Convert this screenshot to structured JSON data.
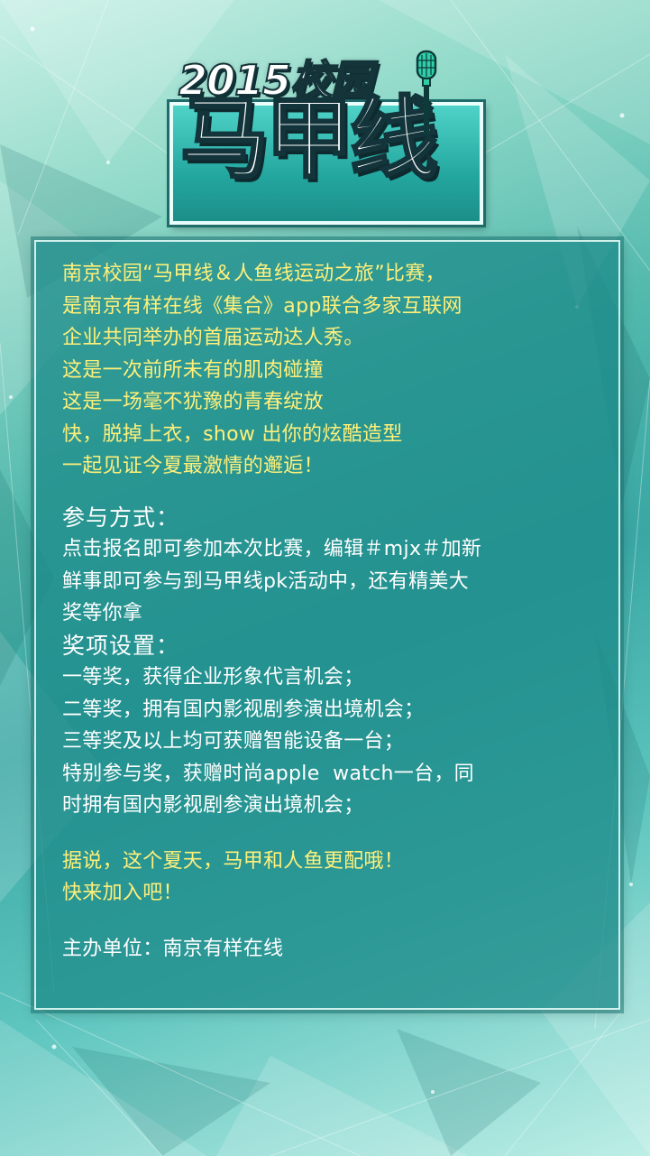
{
  "logo": {
    "year_text": "2015校园",
    "title_text": "马甲线"
  },
  "intro": {
    "lines": [
      "南京校园“马甲线＆人鱼线运动之旅”比赛，",
      "是南京有样在线《集合》app联合多家互联网",
      "企业共同举办的首届运动达人秀。",
      "这是一次前所未有的肌肉碰撞",
      "这是一场毫不犹豫的青春绽放",
      "快，脱掉上衣，show 出你的炫酷造型",
      "一起见证今夏最激情的邂逅！"
    ]
  },
  "participation": {
    "heading": "参与方式：",
    "lines": [
      "点击报名即可参加本次比赛，编辑＃mjx＃加新",
      "鲜事即可参与到马甲线pk活动中，还有精美大",
      "奖等你拿"
    ]
  },
  "prizes": {
    "heading": "奖项设置：",
    "lines": [
      "一等奖，获得企业形象代言机会；",
      "二等奖，拥有国内影视剧参演出境机会；",
      "三等奖及以上均可获赠智能设备一台；",
      "特别参与奖，获赠时尚apple  watch一台，同",
      "时拥有国内影视剧参演出境机会；"
    ]
  },
  "closing": {
    "lines": [
      "据说，这个夏天，马甲和人鱼更配哦！",
      "快来加入吧！"
    ]
  },
  "organizer": {
    "text": "主办单位：南京有样在线"
  },
  "colors": {
    "highlight_text": "#fff07a",
    "body_text": "#ffffff",
    "panel_bg": "#1e8c8a",
    "background": "#52b9ad"
  },
  "icons": {
    "logo_mic": "microphone-icon"
  }
}
